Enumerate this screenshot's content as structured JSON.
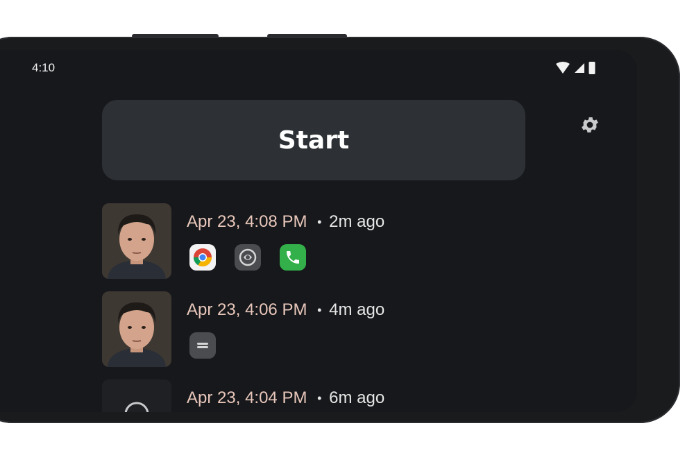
{
  "status_bar": {
    "time": "4:10",
    "icons": [
      "wifi-icon",
      "signal-icon",
      "battery-icon"
    ]
  },
  "start_button": {
    "label": "Start"
  },
  "settings": {
    "icon": "gear-icon"
  },
  "sessions": [
    {
      "date": "Apr 23,",
      "time": "4:08 PM",
      "ago": "2m ago",
      "apps": [
        "chrome-icon",
        "app-icon",
        "phone-icon"
      ]
    },
    {
      "date": "Apr 23,",
      "time": "4:06 PM",
      "ago": "4m ago",
      "apps": [
        "notes-icon"
      ]
    },
    {
      "date": "Apr 23,",
      "time": "4:04 PM",
      "ago": "6m ago",
      "apps": []
    }
  ],
  "colors": {
    "background": "#17181b",
    "card": "#2d3034",
    "accent_date": "#e8c7bb"
  }
}
